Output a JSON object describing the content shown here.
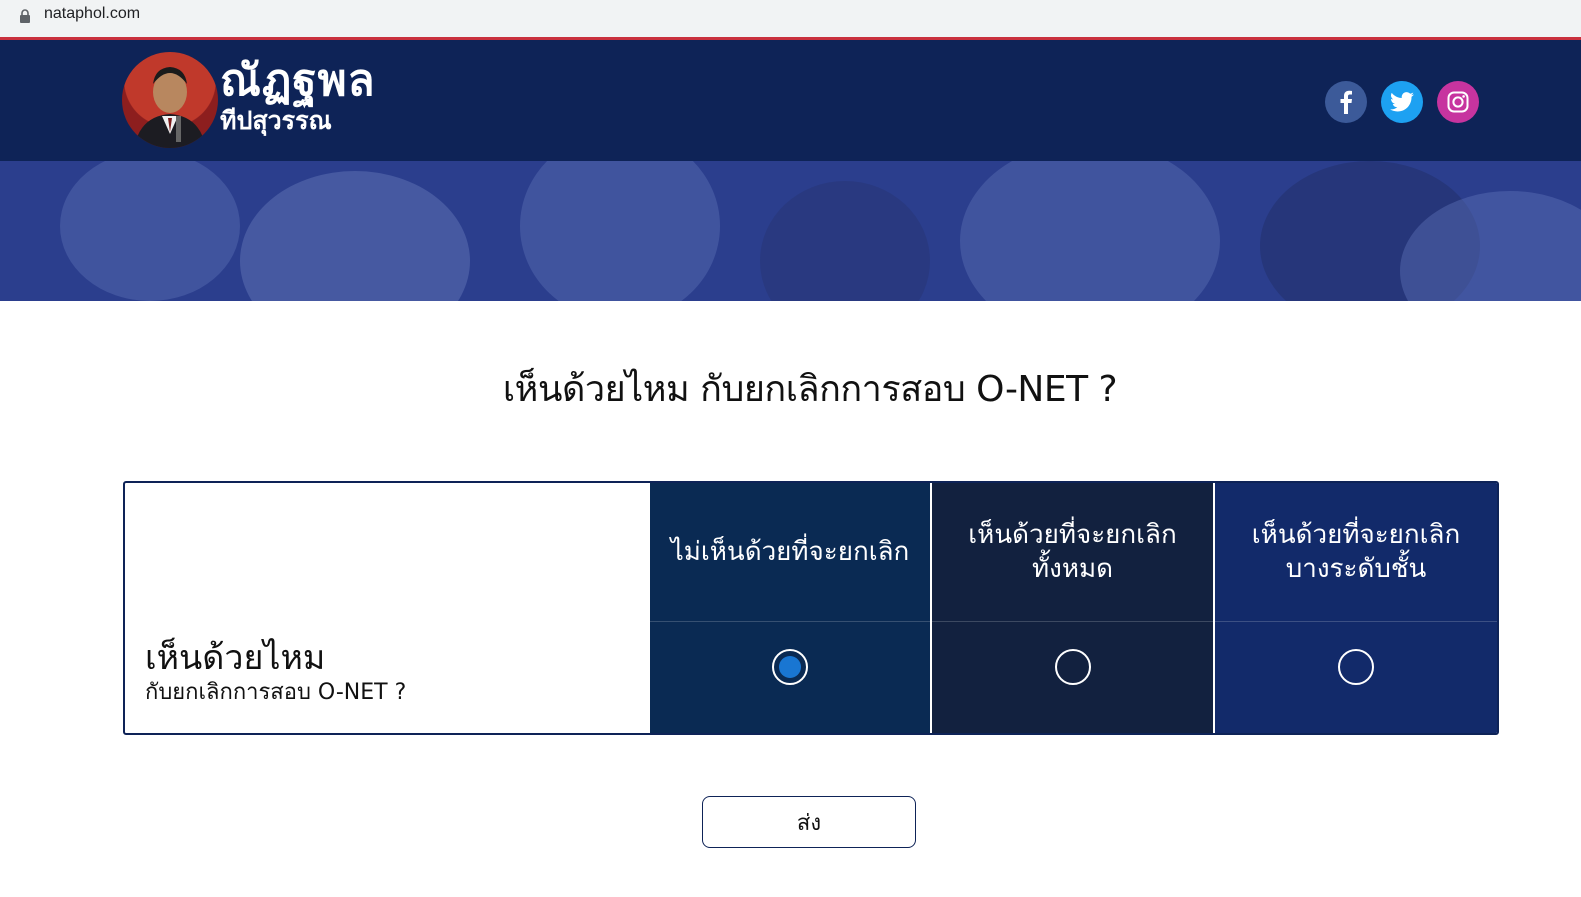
{
  "browser": {
    "url": "nataphol.com"
  },
  "header": {
    "logo_name": "ณัฏฐพล",
    "logo_surname": "ทีปสุวรรณ",
    "social": [
      "facebook-icon",
      "twitter-icon",
      "instagram-icon"
    ]
  },
  "poll": {
    "question": "เห็นด้วยไหม กับยกเลิกการสอบ O-NET ?",
    "row_title": "เห็นด้วยไหม",
    "row_subtitle": "กับยกเลิกการสอบ O-NET ?",
    "options": [
      {
        "label": "ไม่เห็นด้วยที่จะยกเลิก",
        "selected": true
      },
      {
        "label": "เห็นด้วยที่จะยกเลิกทั้งหมด",
        "selected": false
      },
      {
        "label": "เห็นด้วยที่จะยกเลิกบางระดับชั้น",
        "selected": false
      }
    ],
    "submit_label": "ส่ง"
  },
  "colors": {
    "header_bg": "#0e2357",
    "radio_selected": "#1976d2",
    "facebook": "#3c5a99",
    "twitter": "#1da1f2",
    "instagram": "#c7349f"
  }
}
